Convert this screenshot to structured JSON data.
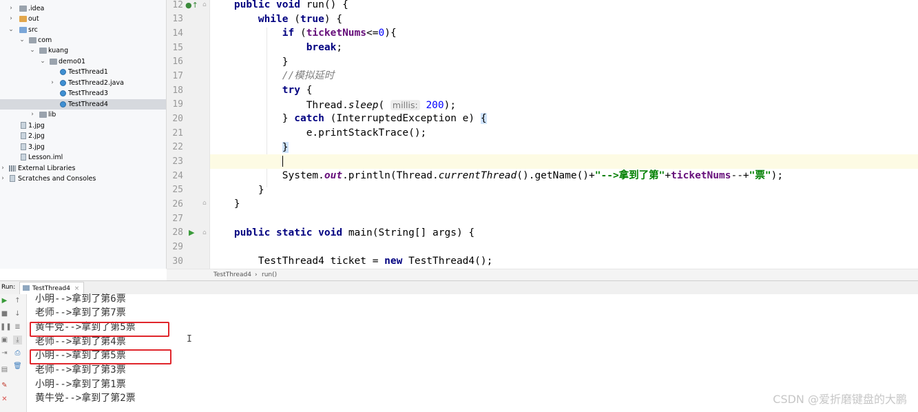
{
  "project_tree": {
    "items": [
      {
        "label": ".idea",
        "type": "folder"
      },
      {
        "label": "out",
        "type": "folder-orange"
      },
      {
        "label": "src",
        "type": "folder-blue"
      },
      {
        "label": "com",
        "type": "folder"
      },
      {
        "label": "kuang",
        "type": "folder"
      },
      {
        "label": "demo01",
        "type": "folder"
      },
      {
        "label": "TestThread1",
        "type": "class"
      },
      {
        "label": "TestThread2.java",
        "type": "class"
      },
      {
        "label": "TestThread3",
        "type": "class"
      },
      {
        "label": "TestThread4",
        "type": "class",
        "selected": true
      },
      {
        "label": "lib",
        "type": "folder"
      },
      {
        "label": "1.jpg",
        "type": "file"
      },
      {
        "label": "2.jpg",
        "type": "file"
      },
      {
        "label": "3.jpg",
        "type": "file"
      },
      {
        "label": "Lesson.iml",
        "type": "file"
      },
      {
        "label": "External Libraries",
        "type": "library"
      },
      {
        "label": "Scratches and Consoles",
        "type": "scratch"
      }
    ]
  },
  "editor": {
    "line_numbers": [
      "12",
      "13",
      "14",
      "15",
      "16",
      "17",
      "18",
      "19",
      "20",
      "21",
      "22",
      "23",
      "24",
      "25",
      "26",
      "27",
      "28",
      "29",
      "30"
    ],
    "current_line": "23",
    "code": {
      "l12": {
        "kw1": "public",
        "kw2": "void",
        "rest": " run() {"
      },
      "l13": {
        "kw": "while",
        "mid": " (",
        "kw2": "true",
        "rest": ") {"
      },
      "l14": {
        "kw": "if",
        "mid": " (",
        "var": "ticketNums",
        "op": "<=",
        "num": "0",
        "rest": "){"
      },
      "l15": {
        "kw": "break",
        "rest": ";"
      },
      "l16": {
        "text": "}"
      },
      "l17": {
        "comment": "//模拟延时"
      },
      "l18": {
        "kw": "try",
        "rest": " {"
      },
      "l19": {
        "pre": "Thread.",
        "method": "sleep",
        "open": "(",
        "hint": "millis:",
        "num": "200",
        "rest": ");"
      },
      "l20": {
        "pre": "} ",
        "kw": "catch",
        "mid": " (InterruptedException e) ",
        "brace": "{"
      },
      "l21": {
        "text": "e.printStackTrace();"
      },
      "l22": {
        "brace": "}"
      },
      "l24": {
        "pre": "System.",
        "field": "out",
        "mid": ".println(Thread.",
        "method": "currentThread",
        "mid2": "().getName()+",
        "str1": "\"-->拿到了第\"",
        "plus1": "+",
        "var": "ticketNums",
        "mid3": "--+",
        "str2": "\"票\"",
        "rest": ");"
      },
      "l25": {
        "text": "}"
      },
      "l26": {
        "text": "}"
      },
      "l28": {
        "kw1": "public",
        "kw2": "static",
        "kw3": "void",
        "rest": " main(String[] args) {"
      },
      "l30": {
        "pre": "TestThread4 ticket = ",
        "kw": "new",
        "rest": " TestThread4();"
      }
    }
  },
  "breadcrumb": {
    "class": "TestThread4",
    "sep": "›",
    "method": "run()"
  },
  "run_panel": {
    "label": "Run:",
    "tab": "TestThread4",
    "tab_close": "×",
    "output": [
      "小明-->拿到了第6票",
      "老师-->拿到了第7票",
      "黄牛党-->拿到了第5票",
      "老师-->拿到了第4票",
      "小明-->拿到了第5票",
      "老师-->拿到了第3票",
      "小明-->拿到了第1票",
      "黄牛党-->拿到了第2票"
    ],
    "highlighted_lines": [
      3,
      5
    ]
  },
  "watermark": "CSDN @爱折磨键盘的大鹏",
  "colors": {
    "keyword": "#000080",
    "string": "#008000",
    "number": "#0000ff",
    "comment": "#808080",
    "highlight_box": "#e0252b"
  }
}
